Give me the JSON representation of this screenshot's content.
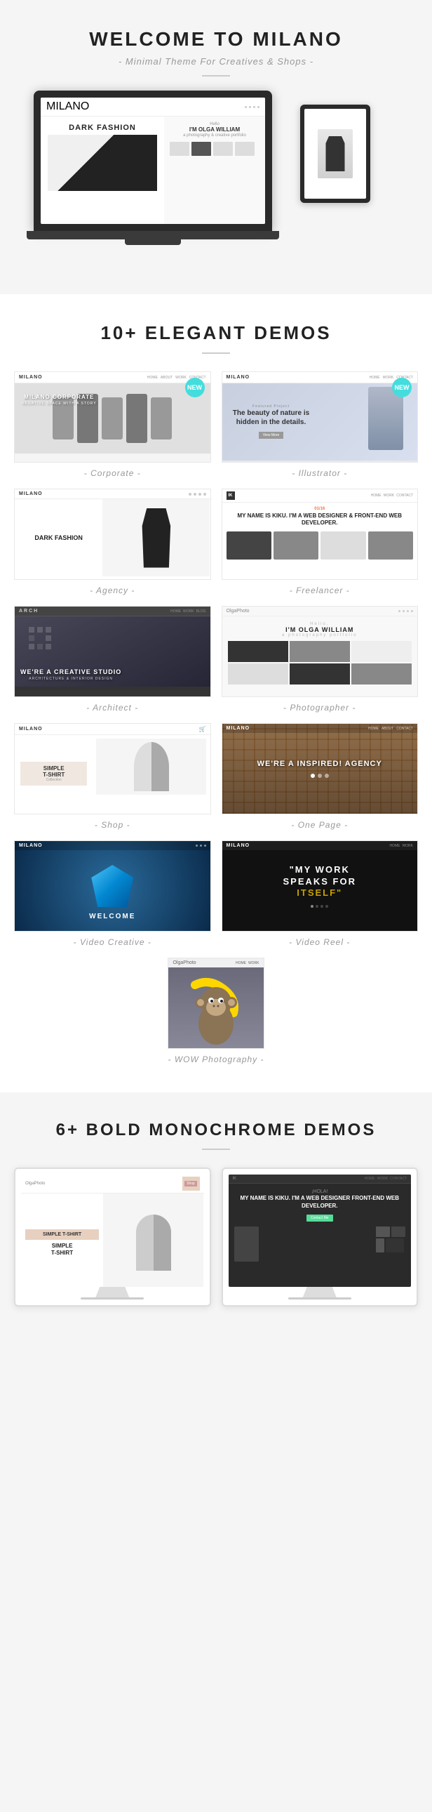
{
  "header": {
    "title": "WELCOME TO MILANO",
    "subtitle": "- Minimal Theme For Creatives & Shops -"
  },
  "screen": {
    "logo": "MILANO",
    "dark_fashion": "DARK FASHION",
    "olga_hello": "Hello",
    "olga_name": "I'M OLGA WILLIAM",
    "olga_sub": "a photography & creative portfolio"
  },
  "elegant_demos": {
    "heading": "10+ ELEGANT DEMOS",
    "demos": [
      {
        "id": "corporate",
        "label": "- Corporate -",
        "new": true
      },
      {
        "id": "illustrator",
        "label": "- Illustrator -",
        "new": true
      },
      {
        "id": "agency",
        "label": "- Agency -"
      },
      {
        "id": "freelancer",
        "label": "- Freelancer -"
      },
      {
        "id": "architect",
        "label": "- Architect -"
      },
      {
        "id": "photographer",
        "label": "- Photographer -"
      },
      {
        "id": "shop",
        "label": "- Shop -"
      },
      {
        "id": "onepage",
        "label": "- One Page -"
      },
      {
        "id": "video-creative",
        "label": "- Video Creative -"
      },
      {
        "id": "video-reel",
        "label": "- Video Reel -"
      },
      {
        "id": "wow-photography",
        "label": "- WOW Photography -"
      }
    ],
    "corporate_headline": "MILANO CORPORATE",
    "corporate_sub": "Negative space with a story",
    "illustrator_quote": "The beauty of nature is hidden in the details.",
    "agency_dark_fashion": "DARK FASHION",
    "freelancer_tag": "01/16",
    "freelancer_name": "MY NAME IS KIKU. I'M A WEB DESIGNER & FRONT-END WEB DEVELOPER.",
    "photographer_title": "I'M OLGA WILLIAM",
    "architect_text": "WE'RE A CREATIVE STUDIO",
    "architect_sub": "Architecture & Interior Design",
    "onepage_text": "WE'RE A INSPIRED! AGENCY",
    "video_creative_welcome": "WELCOME",
    "video_reel_text1": "\"MY WORK",
    "video_reel_text2": "SPEAKS FOR",
    "video_reel_text3": "ITSELF\""
  },
  "monochrome": {
    "heading": "6+ BOLD MONOCHROME DEMOS",
    "shop_title": "SIMPLE T-SHIRT",
    "freelancer_hola": "¡HOLA!",
    "freelancer_name": "MY NAME IS KIKU. I'M A WEB DESIGNER FRONT-END WEB DEVELOPER."
  }
}
